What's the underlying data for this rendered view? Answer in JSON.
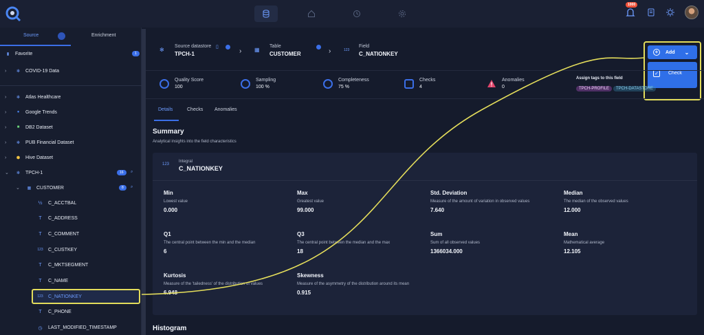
{
  "topbar": {
    "logo_icon": "search-logo-icon",
    "nav": [
      "datastore-icon",
      "explore-icon",
      "library-icon",
      "settings-icon"
    ],
    "notification_count": "1000",
    "actions": [
      "notification-icon",
      "docs-icon",
      "theme-icon",
      "avatar"
    ]
  },
  "sidebar": {
    "tabs": {
      "source": "Source",
      "enrichment": "Enrichment"
    },
    "favorite": {
      "label": "Favorite",
      "count": "1"
    },
    "items": [
      {
        "label": "COVID-19 Data"
      },
      {
        "label": "Atlas Healthcare"
      },
      {
        "label": "Google Trends"
      },
      {
        "label": "DB2 Dataset"
      },
      {
        "label": "PUB Financial Dataset"
      },
      {
        "label": "Hive Dataset"
      },
      {
        "label": "TPCH-1",
        "count": "16"
      },
      {
        "label": "CUSTOMER",
        "count": "8"
      }
    ],
    "fields": [
      {
        "label": "C_ACCTBAL",
        "icon": "½"
      },
      {
        "label": "C_ADDRESS",
        "icon": "T"
      },
      {
        "label": "C_COMMENT",
        "icon": "T"
      },
      {
        "label": "C_CUSTKEY",
        "icon": "123"
      },
      {
        "label": "C_MKTSEGMENT",
        "icon": "T"
      },
      {
        "label": "C_NAME",
        "icon": "T"
      },
      {
        "label": "C_NATIONKEY",
        "icon": "123"
      },
      {
        "label": "C_PHONE",
        "icon": "T"
      },
      {
        "label": "LAST_MODIFIED_TIMESTAMP",
        "icon": "◷"
      }
    ]
  },
  "breadcrumb": {
    "datastore_caption": "Source datastore",
    "datastore": "TPCH-1",
    "table_caption": "Table",
    "table": "CUSTOMER",
    "field_caption": "Field",
    "field": "C_NATIONKEY"
  },
  "actions": {
    "add": "Add",
    "check": "Check"
  },
  "metrics": {
    "quality_score": {
      "label": "Quality Score",
      "value": "100"
    },
    "sampling": {
      "label": "Sampling",
      "value": "100 %"
    },
    "completeness": {
      "label": "Completeness",
      "value": "75 %"
    },
    "checks": {
      "label": "Checks",
      "value": "4"
    },
    "anomalies": {
      "label": "Anomalies",
      "value": "0"
    }
  },
  "tags": {
    "caption": "Assign tags to this field",
    "items": [
      {
        "label": "TPCH-PROFILE",
        "color": "#c25bd8"
      },
      {
        "label": "TPCH-DATASTORE",
        "color": "#3a8fb8"
      }
    ]
  },
  "tabs": [
    "Details",
    "Checks",
    "Anomalies"
  ],
  "summary": {
    "title": "Summary",
    "subtitle": "Analytical insights into the field characteristics",
    "field_type": "Integral",
    "field_name": "C_NATIONKEY",
    "stats": [
      {
        "title": "Min",
        "desc": "Lowest value",
        "value": "0.000"
      },
      {
        "title": "Max",
        "desc": "Greatest value",
        "value": "99.000"
      },
      {
        "title": "Std. Deviation",
        "desc": "Measure of the amount of variation in observed values",
        "value": "7.640"
      },
      {
        "title": "Median",
        "desc": "The median of the observed values",
        "value": "12.000"
      },
      {
        "title": "Q1",
        "desc": "The central point between the min and the median",
        "value": "6"
      },
      {
        "title": "Q3",
        "desc": "The central point between the median and the max",
        "value": "18"
      },
      {
        "title": "Sum",
        "desc": "Sum of all observed values",
        "value": "1366034.000"
      },
      {
        "title": "Mean",
        "desc": "Mathematical average",
        "value": "12.105"
      },
      {
        "title": "Kurtosis",
        "desc": "Measure of the 'tailedness' of the distribution of values",
        "value": "6.948"
      },
      {
        "title": "Skewness",
        "desc": "Measure of the asymmetry of the distribution around its mean",
        "value": "0.915"
      }
    ]
  },
  "histogram": {
    "title": "Histogram"
  }
}
